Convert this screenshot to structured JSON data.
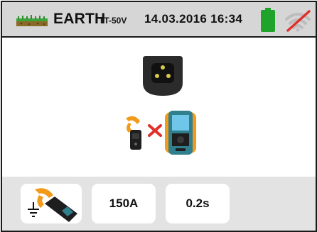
{
  "header": {
    "title": "EARTH",
    "subtitle": "TT-50V",
    "datetime": "14.03.2016 16:34",
    "icons": [
      "earth-ground-icon",
      "battery-icon",
      "wifi-disabled-icon"
    ]
  },
  "main": {
    "icons": [
      "schuko-socket-icon",
      "clamp-icon",
      "not-connected-cross-icon",
      "meter-instrument-icon"
    ]
  },
  "footer": {
    "buttons": [
      {
        "label": "",
        "icon": "clamp-earth-icon"
      },
      {
        "label": "150A"
      },
      {
        "label": "0.2s"
      }
    ]
  },
  "colors": {
    "header_bg": "#d6d6d6",
    "footer_bg": "#e3e3e3",
    "battery": "#1fa32a",
    "wifi_slash": "#e0302a",
    "clamp_orange": "#f29a1a",
    "meter_teal": "#2f7f8e"
  }
}
